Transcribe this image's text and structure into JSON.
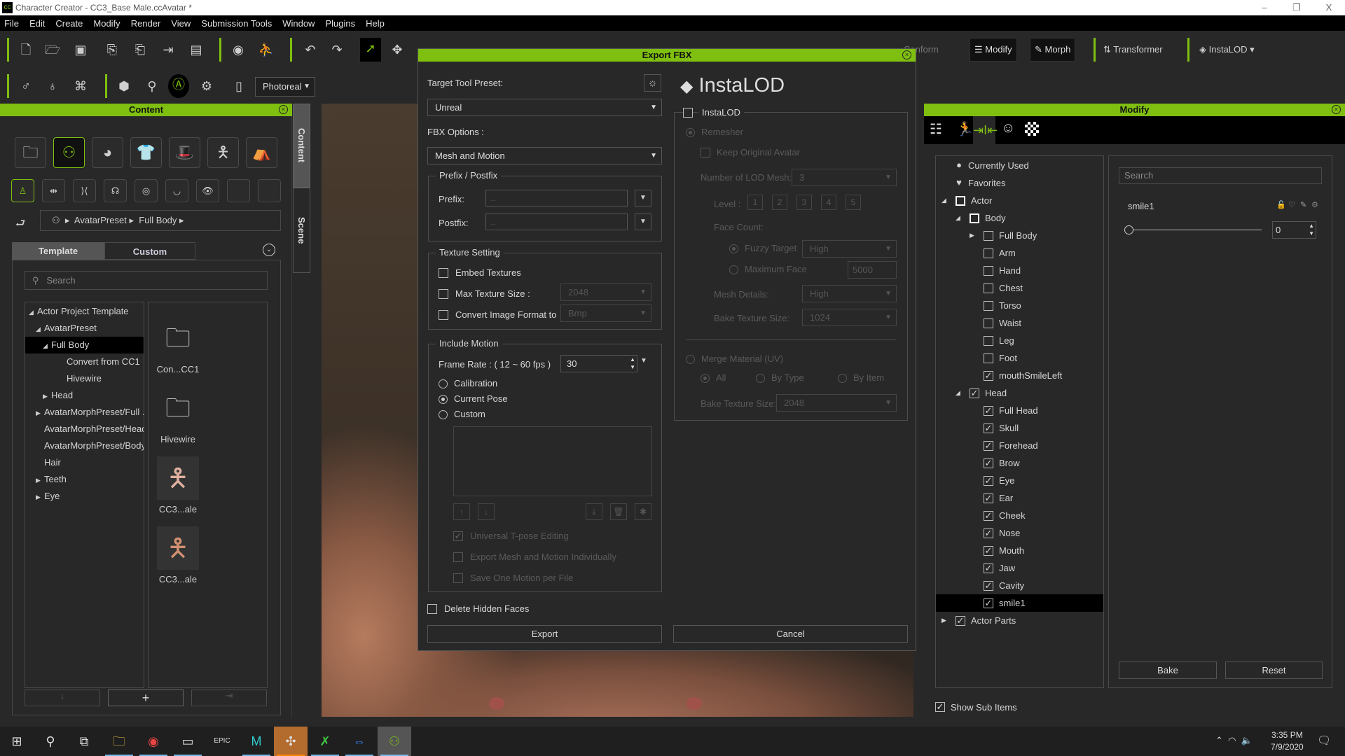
{
  "window": {
    "title": "Character Creator - CC3_Base Male.ccAvatar *",
    "minimize": "–",
    "restore": "❐",
    "close": "X"
  },
  "menu": [
    "File",
    "Edit",
    "Create",
    "Modify",
    "Render",
    "View",
    "Submission Tools",
    "Window",
    "Plugins",
    "Help"
  ],
  "toolbar": {
    "conform": "Conform",
    "modify": "Modify",
    "morph": "Morph",
    "transformer": "Transformer",
    "instalod": "InstaLOD",
    "render_mode": "Photoreal",
    "accent": "#7fbf10"
  },
  "content_panel": {
    "title": "Content",
    "side_tabs": [
      "Content",
      "Scene"
    ],
    "breadcrumb": [
      "AvatarPreset",
      "Full Body"
    ],
    "tabs": [
      "Template",
      "Custom"
    ],
    "active_tab": "Template",
    "search_placeholder": "Search",
    "tree": [
      {
        "label": "Actor Project Template",
        "level": 0,
        "arrow": "down"
      },
      {
        "label": "AvatarPreset",
        "level": 1,
        "arrow": "down"
      },
      {
        "label": "Full Body",
        "level": 2,
        "arrow": "down",
        "selected": true
      },
      {
        "label": "Convert from CC1",
        "level": 3,
        "arrow": ""
      },
      {
        "label": "Hivewire",
        "level": 3,
        "arrow": ""
      },
      {
        "label": "Head",
        "level": 2,
        "arrow": "right"
      },
      {
        "label": "AvatarMorphPreset/Full ...",
        "level": 1,
        "arrow": "right"
      },
      {
        "label": "AvatarMorphPreset/Head",
        "level": 1,
        "arrow": ""
      },
      {
        "label": "AvatarMorphPreset/Body",
        "level": 1,
        "arrow": ""
      },
      {
        "label": "Hair",
        "level": 1,
        "arrow": ""
      },
      {
        "label": "Teeth",
        "level": 1,
        "arrow": "right"
      },
      {
        "label": "Eye",
        "level": 1,
        "arrow": "right"
      }
    ],
    "thumbnails": [
      {
        "label": "Con...CC1",
        "kind": "folder"
      },
      {
        "label": "Hivewire",
        "kind": "folder"
      },
      {
        "label": "CC3...ale",
        "kind": "female-figure"
      },
      {
        "label": "CC3...ale",
        "kind": "male-figure"
      }
    ]
  },
  "dialog": {
    "title": "Export FBX",
    "target_preset_label": "Target Tool Preset:",
    "target_preset_value": "Unreal",
    "fbx_options_label": "FBX Options :",
    "fbx_options_value": "Mesh and Motion",
    "prefix_group": "Prefix / Postfix",
    "prefix_label": "Prefix:",
    "postfix_label": "Postfix:",
    "prefix_placeholder": "...",
    "postfix_placeholder": "...",
    "texture_group": "Texture Setting",
    "embed_textures": "Embed Textures",
    "max_texture_size": "Max Texture Size :",
    "max_texture_value": "2048",
    "convert_format": "Convert Image Format to",
    "convert_format_value": "Bmp",
    "motion_group": "Include Motion",
    "frame_rate_label": "Frame Rate : ( 12 ~ 60 fps )",
    "frame_rate_value": "30",
    "motion_options": [
      "Calibration",
      "Current Pose",
      "Custom"
    ],
    "motion_selected": "Current Pose",
    "universal_tpose": "Universal T-pose Editing",
    "export_individually": "Export Mesh and Motion Individually",
    "one_motion_per_file": "Save One Motion per File",
    "delete_hidden_faces": "Delete Hidden Faces",
    "export_button": "Export",
    "cancel_button": "Cancel",
    "instalod": {
      "logo": "InstaLOD",
      "enable_label": "InstaLOD",
      "remesher": "Remesher",
      "keep_original": "Keep Original Avatar",
      "num_lod_label": "Number of LOD Mesh:",
      "num_lod_value": "3",
      "level_label": "Level :",
      "levels": [
        "1",
        "2",
        "3",
        "4",
        "5"
      ],
      "face_count_label": "Face Count:",
      "fuzzy_target": "Fuzzy Target",
      "fuzzy_value": "High",
      "maximum_face": "Maximum Face",
      "maximum_face_value": "5000",
      "mesh_details_label": "Mesh Details:",
      "mesh_details_value": "High",
      "bake_texture_label": "Bake Texture Size:",
      "bake_texture_value": "1024",
      "merge_material": "Merge Material (UV)",
      "merge_options": [
        "All",
        "By Type",
        "By Item"
      ],
      "merge_bake_label": "Bake Texture Size:",
      "merge_bake_value": "2048"
    }
  },
  "modify_panel": {
    "title": "Modify",
    "tree": [
      {
        "label": "Currently Used",
        "level": 0,
        "mark": "dot"
      },
      {
        "label": "Favorites",
        "level": 0,
        "mark": "heart"
      },
      {
        "label": "Actor",
        "level": 0,
        "mark": "partial",
        "arrow": "down"
      },
      {
        "label": "Body",
        "level": 1,
        "mark": "partial",
        "arrow": "down"
      },
      {
        "label": "Full Body",
        "level": 2,
        "mark": "unchecked",
        "arrow": "right"
      },
      {
        "label": "Arm",
        "level": 2,
        "mark": "unchecked"
      },
      {
        "label": "Hand",
        "level": 2,
        "mark": "unchecked"
      },
      {
        "label": "Chest",
        "level": 2,
        "mark": "unchecked"
      },
      {
        "label": "Torso",
        "level": 2,
        "mark": "unchecked"
      },
      {
        "label": "Waist",
        "level": 2,
        "mark": "unchecked"
      },
      {
        "label": "Leg",
        "level": 2,
        "mark": "unchecked"
      },
      {
        "label": "Foot",
        "level": 2,
        "mark": "unchecked"
      },
      {
        "label": "mouthSmileLeft",
        "level": 2,
        "mark": "checked"
      },
      {
        "label": "Head",
        "level": 1,
        "mark": "checked",
        "arrow": "down"
      },
      {
        "label": "Full Head",
        "level": 2,
        "mark": "checked"
      },
      {
        "label": "Skull",
        "level": 2,
        "mark": "checked"
      },
      {
        "label": "Forehead",
        "level": 2,
        "mark": "checked"
      },
      {
        "label": "Brow",
        "level": 2,
        "mark": "checked"
      },
      {
        "label": "Eye",
        "level": 2,
        "mark": "checked"
      },
      {
        "label": "Ear",
        "level": 2,
        "mark": "checked"
      },
      {
        "label": "Cheek",
        "level": 2,
        "mark": "checked"
      },
      {
        "label": "Nose",
        "level": 2,
        "mark": "checked"
      },
      {
        "label": "Mouth",
        "level": 2,
        "mark": "checked"
      },
      {
        "label": "Jaw",
        "level": 2,
        "mark": "checked"
      },
      {
        "label": "Cavity",
        "level": 2,
        "mark": "checked"
      },
      {
        "label": "smile1",
        "level": 2,
        "mark": "checked",
        "selected": true
      },
      {
        "label": "Actor Parts",
        "level": 0,
        "mark": "checked",
        "arrow": "right"
      }
    ],
    "search_placeholder": "Search",
    "morph_name": "smile1",
    "morph_value": "0",
    "slider_fraction": 0,
    "bake_button": "Bake",
    "reset_button": "Reset",
    "show_sub_items": "Show Sub Items"
  },
  "taskbar": {
    "time": "3:35 PM",
    "date": "7/9/2020"
  }
}
